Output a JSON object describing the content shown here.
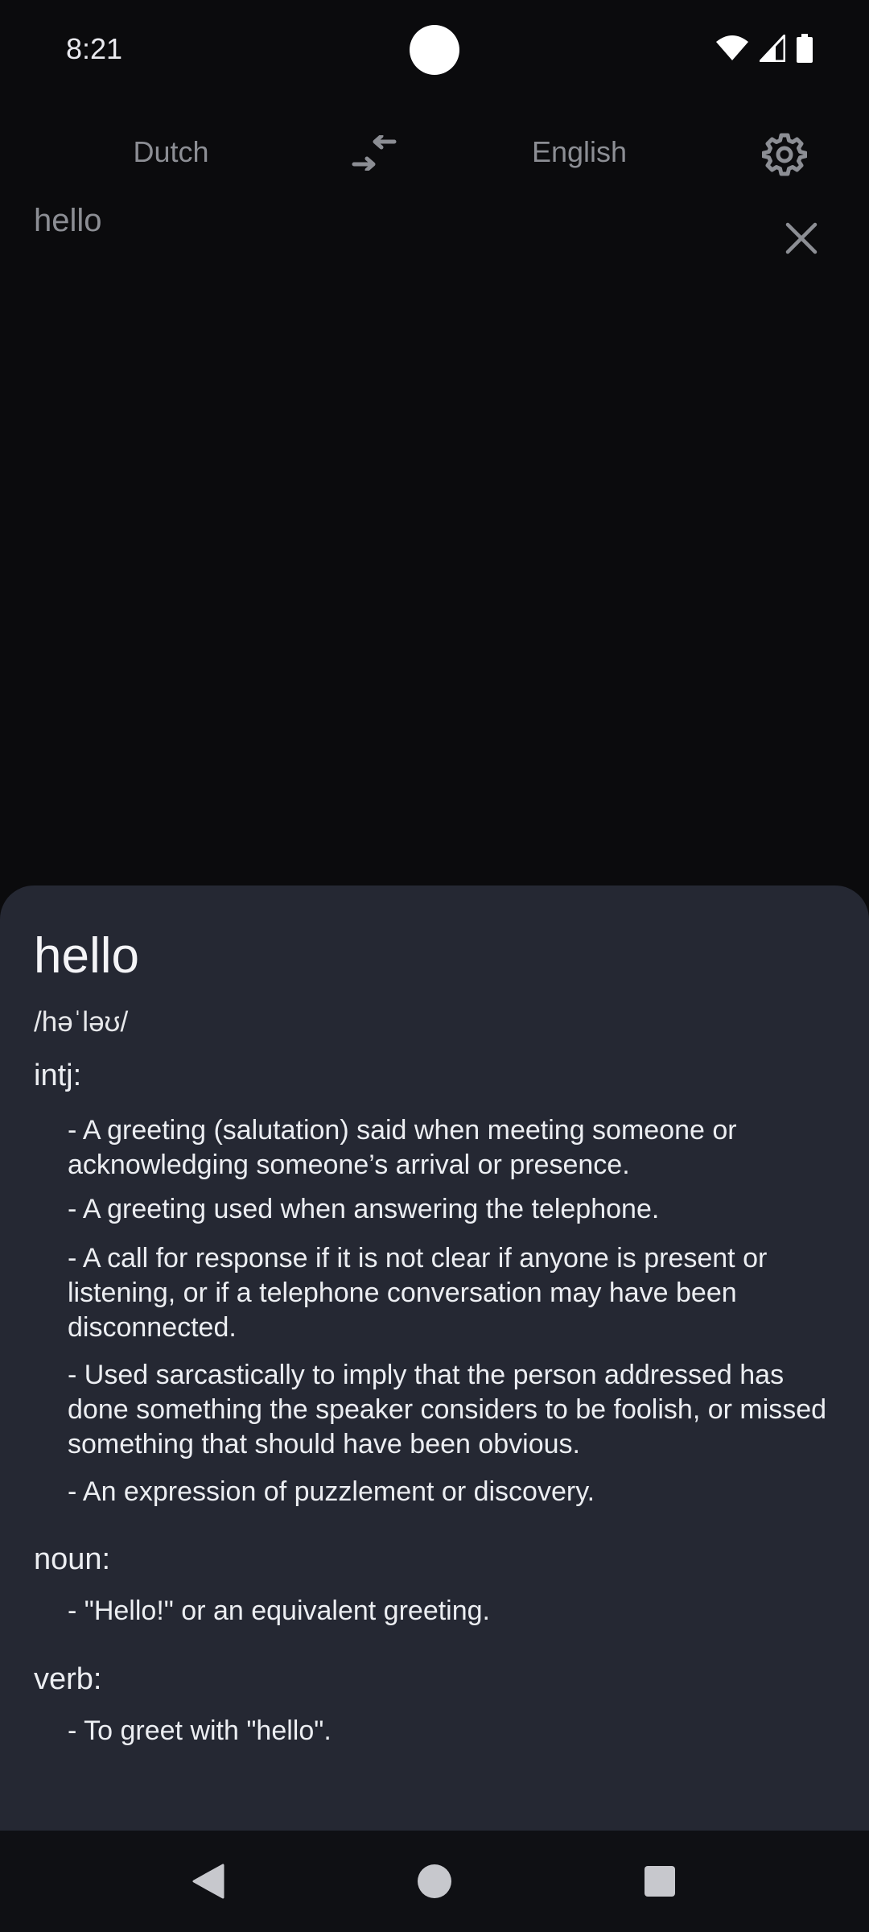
{
  "status_bar": {
    "time": "8:21",
    "icons": [
      "wifi-icon",
      "cell-signal-icon",
      "battery-icon"
    ]
  },
  "header": {
    "source_language": "Dutch",
    "target_language": "English",
    "swap_icon": "swap-languages-icon",
    "settings_icon": "gear-icon"
  },
  "input": {
    "text": "hello",
    "clear_icon": "close-icon"
  },
  "definition": {
    "word": "hello",
    "phonetic": "/həˈləʊ/",
    "sections": [
      {
        "pos": "intj:",
        "definitions": [
          "- A greeting (salutation) said when meeting someone or acknowledging someone’s arrival or presence.",
          "- A greeting used when answering the telephone.",
          "- A call for response if it is not clear if anyone is present or listening, or if a telephone conversation may have been disconnected.",
          "- Used sarcastically to imply that the person addressed has done something the speaker considers to be foolish, or missed something that should have been obvious.",
          "- An expression of puzzlement or discovery."
        ]
      },
      {
        "pos": "noun:",
        "definitions": [
          "- \"Hello!\" or an equivalent greeting."
        ]
      },
      {
        "pos": "verb:",
        "definitions": [
          "- To greet with \"hello\"."
        ]
      }
    ]
  },
  "nav_bar": {
    "back_icon": "back-triangle-icon",
    "home_icon": "home-circle-icon",
    "recents_icon": "recents-square-icon"
  },
  "colors": {
    "background": "#0b0b0d",
    "sheet": "#252833",
    "muted_text": "#8c8e94",
    "text": "#f1f2f5"
  }
}
